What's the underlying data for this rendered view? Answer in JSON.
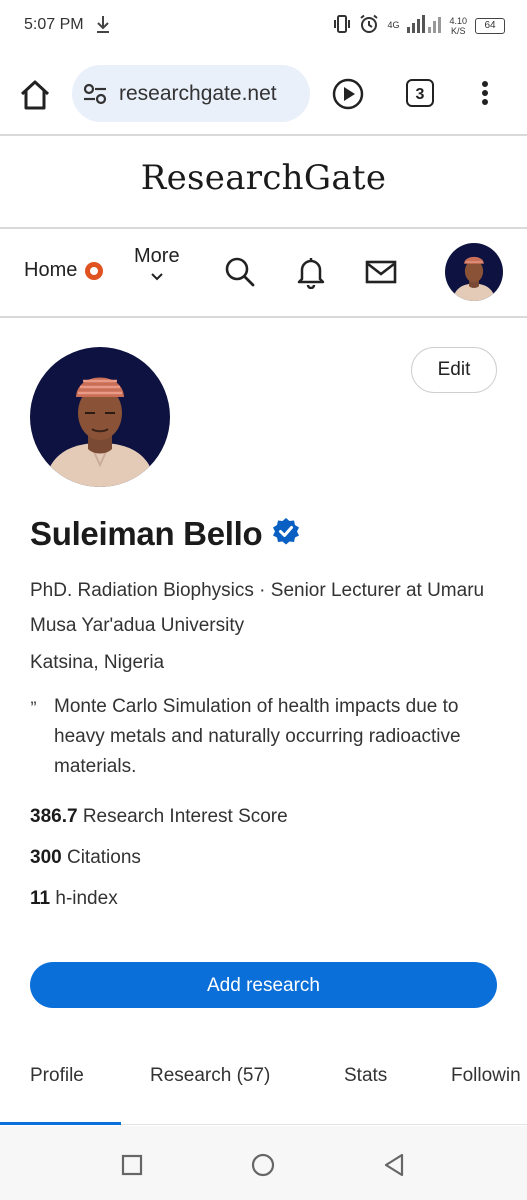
{
  "status_bar": {
    "time": "5:07 PM",
    "network": "4G",
    "speed_top": "4.10",
    "speed_bottom": "K/S",
    "battery": "64"
  },
  "browser": {
    "url": "researchgate.net",
    "tab_count": "3"
  },
  "site": {
    "logo": "ResearchGate"
  },
  "nav": {
    "home_label": "Home",
    "more_label": "More"
  },
  "profile": {
    "edit_label": "Edit",
    "name": "Suleiman Bello",
    "headline": "PhD. Radiation Biophysics · Senior Lecturer at Umaru Musa Yar'adua University",
    "location": "Katsina, Nigeria",
    "quote_mark": "”",
    "research_interest": "Monte Carlo Simulation of health impacts due to heavy metals and naturally occurring radioactive materials.",
    "stats": [
      {
        "value": "386.7",
        "label": "Research Interest Score"
      },
      {
        "value": "300",
        "label": "Citations"
      },
      {
        "value": "11",
        "label": "h-index"
      }
    ],
    "add_research_label": "Add research"
  },
  "tabs": [
    {
      "label": "Profile",
      "active": true
    },
    {
      "label": "Research (57)",
      "active": false
    },
    {
      "label": "Stats",
      "active": false
    },
    {
      "label": "Followin",
      "active": false
    }
  ],
  "colors": {
    "accent": "#0a6fd8",
    "badge": "#e0521f",
    "verified": "#0a5fc2"
  },
  "icons": [
    "download-icon",
    "vibrate-icon",
    "alarm-icon",
    "signal-icon",
    "battery-icon",
    "home-icon",
    "tune-icon",
    "play-icon",
    "more-vert-icon",
    "chevron-down-icon",
    "search-icon",
    "bell-icon",
    "mail-icon",
    "verified-badge-icon",
    "square-icon",
    "circle-icon",
    "back-icon"
  ]
}
